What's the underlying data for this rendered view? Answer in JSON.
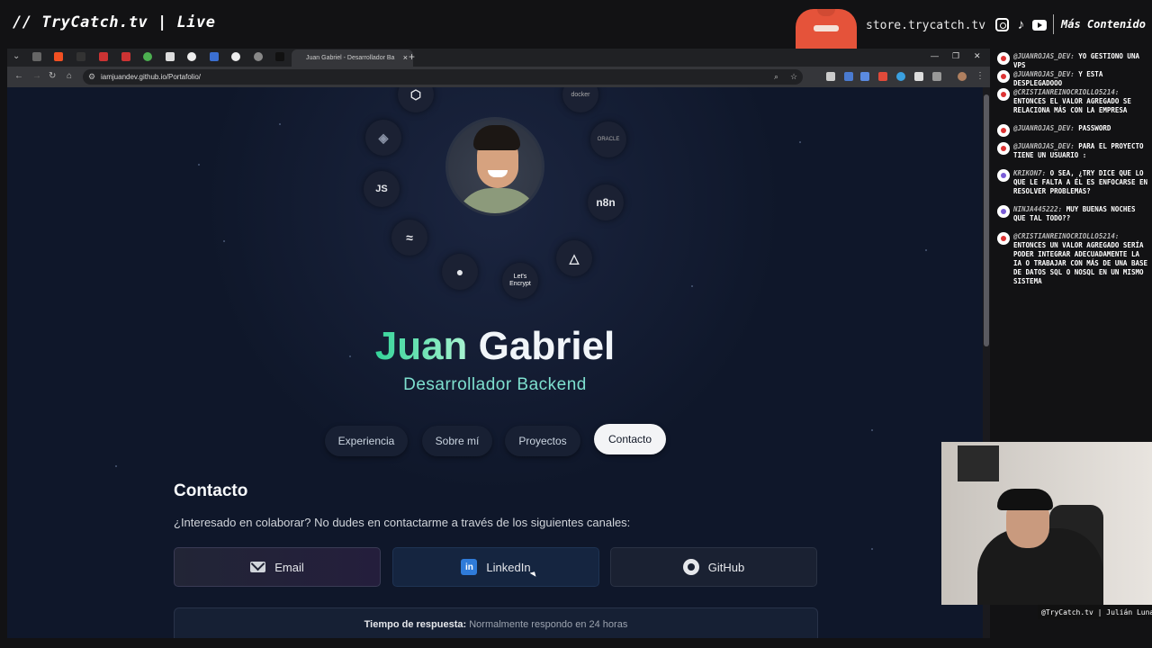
{
  "overlay": {
    "stream_title": "// TryCatch.tv | Live",
    "store_url": "store.trycatch.tv",
    "more_content": "Más Contenido",
    "cam_label": "@TryCatch.tv | Julián Luna",
    "social_icons": [
      "instagram-icon",
      "tiktok-icon",
      "youtube-icon"
    ]
  },
  "browser": {
    "active_tab_title": "Juan Gabriel - Desarrollador Ba",
    "url": "iamjuandev.github.io/Portafolio/"
  },
  "page": {
    "tech_icons": [
      "html5-icon",
      "docker-icon",
      "laravel-icon",
      "oracle-icon",
      "javascript-icon",
      "n8n-icon",
      "tailwind-icon",
      "linux-icon",
      "meilisearch-icon",
      "letsencrypt-icon"
    ],
    "tech_text": {
      "docker": "docker",
      "oracle": "ORACLE",
      "n8n": "n8n",
      "letsencrypt": "Let's Encrypt"
    },
    "name_first": "Juan",
    "name_last": "Gabriel",
    "role": "Desarrollador Backend",
    "nav": [
      "Experiencia",
      "Sobre mí",
      "Proyectos",
      "Contacto"
    ],
    "active_nav": "Contacto",
    "contact_title": "Contacto",
    "contact_desc": "¿Interesado en colaborar? No dudes en contactarme a través de los siguientes canales:",
    "contacts": [
      {
        "label": "Email",
        "icon": "mail-icon"
      },
      {
        "label": "LinkedIn",
        "icon": "linkedin-icon"
      },
      {
        "label": "GitHub",
        "icon": "github-icon"
      }
    ],
    "response_label": "Tiempo de respuesta:",
    "response_value": "Normalmente respondo en 24 horas"
  },
  "chat": [
    {
      "user": "@JUANROJAS_DEV:",
      "text": "YO GESTIONO UNA VPS"
    },
    {
      "user": "@JUANROJAS_DEV:",
      "text": "Y ESTA DESPLEGADOOO"
    },
    {
      "user": "@CRISTIANREINOCRIOLLO5214:",
      "text": "ENTONCES EL VALOR AGREGADO SE RELACIONA MÁS CON LA EMPRESA"
    },
    {
      "user": "@JUANROJAS_DEV:",
      "text": "PASSWORD"
    },
    {
      "user": "@JUANROJAS_DEV:",
      "text": "PARA EL PROYECTO TIENE UN USUARIO :"
    },
    {
      "user": "KRIKON7:",
      "text": "O SEA, ¿TRY DICE QUE LO QUE LE FALTA A ÉL ES ENFOCARSE EN RESOLVER PROBLEMAS?"
    },
    {
      "user": "NINJA445222:",
      "text": "MUY BUENAS NOCHES QUE TAL TODO??"
    },
    {
      "user": "@CRISTIANREINOCRIOLLO5214:",
      "text": "ENTONCES UN VALOR AGREGADO SERÍA PODER INTEGRAR ADECUADAMENTE LA IA O TRABAJAR CON MÁS DE UNA BASE DE DATOS SQL O NOSQL EN UN MISMO SISTEMA"
    }
  ],
  "colors": {
    "accent": "#6ee7b7",
    "role": "#7ee0cf",
    "page_bg": "#0f172a",
    "linkedin": "#2f7bd9"
  }
}
